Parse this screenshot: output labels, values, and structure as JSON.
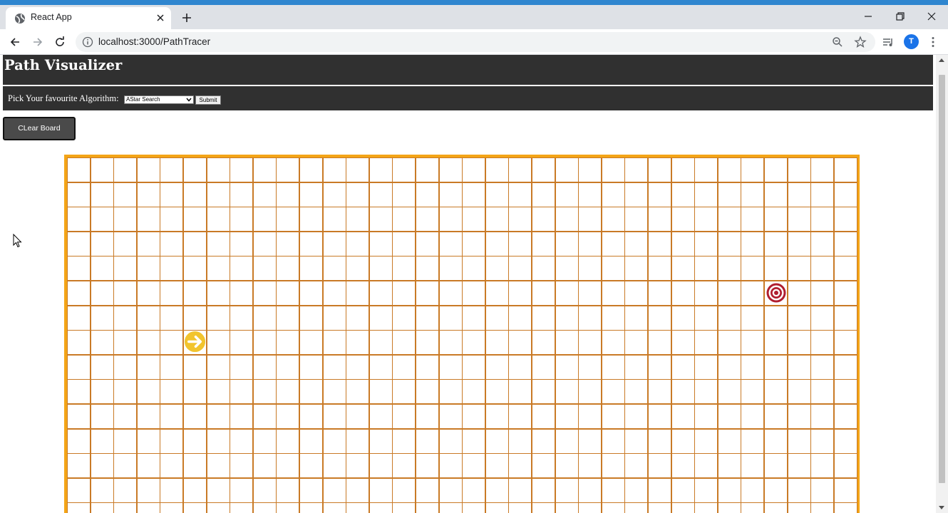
{
  "browser": {
    "tab_title": "React App",
    "url": "localhost:3000/PathTracer",
    "profile_initial": "T"
  },
  "app": {
    "title": "Path Visualizer",
    "pick_label": "Pick Your favourite Algorithm:",
    "algorithm_selected": "AStar Search",
    "submit_label": "Submit",
    "clear_label": "CLear Board"
  },
  "grid": {
    "visible_columns": 34,
    "visible_rows": 15,
    "start_cell": {
      "row": 7,
      "col": 5
    },
    "target_cell": {
      "row": 5,
      "col": 30
    }
  },
  "colors": {
    "header_bg": "#303030",
    "grid_border": "#f4a517",
    "cell_border": "#c97a26",
    "start_color": "#f2c42d",
    "target_color": "#b01e2f",
    "chrome_accent": "#2f86cf"
  },
  "icons": {
    "start": "arrow-right-circle-icon",
    "target": "bullseye-icon"
  }
}
